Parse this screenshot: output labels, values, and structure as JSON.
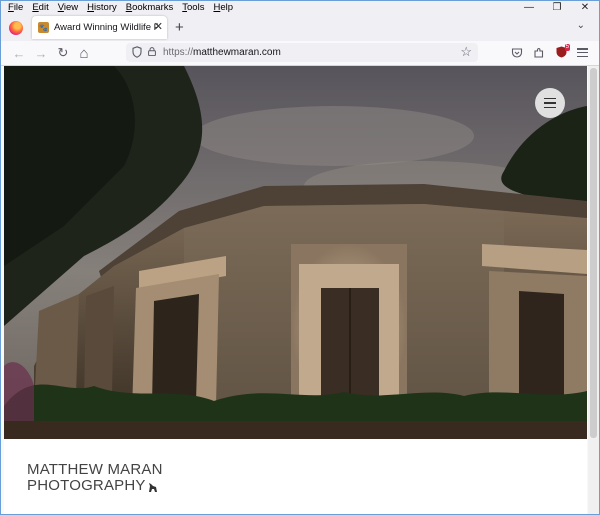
{
  "menubar": {
    "items": [
      {
        "underline": "F",
        "rest": "ile"
      },
      {
        "underline": "E",
        "rest": "dit"
      },
      {
        "underline": "V",
        "rest": "iew"
      },
      {
        "underline": "H",
        "rest": "istory"
      },
      {
        "underline": "B",
        "rest": "ookmarks"
      },
      {
        "underline": "T",
        "rest": "ools"
      },
      {
        "underline": "H",
        "rest": "elp"
      }
    ],
    "minimize_glyph": "—",
    "restore_glyph": "❐",
    "close_glyph": "✕"
  },
  "tab": {
    "title": "Award Winning Wildlife Photography",
    "close_glyph": "✕",
    "new_tab_glyph": "+",
    "list_glyph": "⌄"
  },
  "navbar": {
    "back_glyph": "←",
    "forward_glyph": "→",
    "reload_glyph": "↻",
    "home_glyph": "⌂",
    "url_protocol": "https://",
    "url_host": "matthewmaran.com",
    "star_glyph": "☆",
    "extension_badge": "5"
  },
  "page": {
    "logo_line1": "MATTHEW MARAN",
    "logo_line2": "PHOTOGRAPHY"
  },
  "colors": {
    "accent": "#6a9ed6",
    "badge": "#d7264c"
  }
}
